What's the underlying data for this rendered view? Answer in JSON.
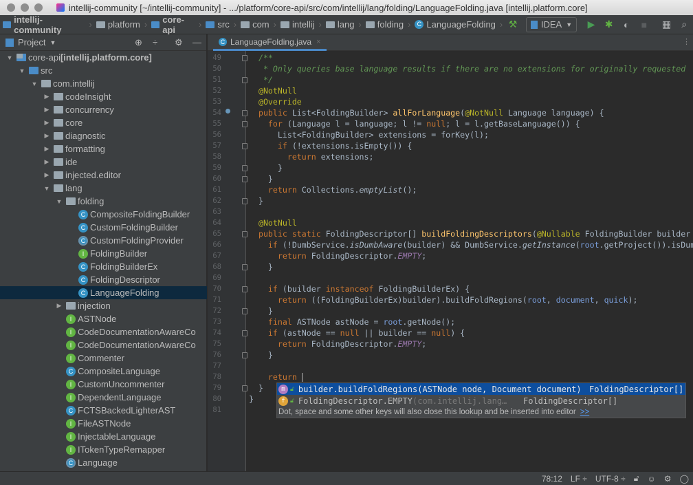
{
  "window": {
    "title": "intellij-community [~/intellij-community] - .../platform/core-api/src/com/intellij/lang/folding/LanguageFolding.java [intellij.platform.core]"
  },
  "navbar": {
    "crumbs": [
      {
        "label": "intellij-community",
        "icon": "module-folder-icon",
        "bold": true
      },
      {
        "label": "platform",
        "icon": "folder-icon",
        "bold": false
      },
      {
        "label": "core-api",
        "icon": "module-folder-icon",
        "bold": true
      },
      {
        "label": "src",
        "icon": "source-folder-icon",
        "bold": false
      },
      {
        "label": "com",
        "icon": "package-icon",
        "bold": false
      },
      {
        "label": "intellij",
        "icon": "package-icon",
        "bold": false
      },
      {
        "label": "lang",
        "icon": "package-icon",
        "bold": false
      },
      {
        "label": "folding",
        "icon": "package-icon",
        "bold": false
      },
      {
        "label": "LanguageFolding",
        "icon": "class-icon",
        "bold": false
      }
    ],
    "run_config": "IDEA"
  },
  "project_panel": {
    "title": "Project",
    "tree": [
      {
        "level": 0,
        "arrow": "open",
        "icon": "mod",
        "label": "core-api",
        "suffix": " [intellij.platform.core]"
      },
      {
        "level": 1,
        "arrow": "open",
        "icon": "srcf",
        "label": "src"
      },
      {
        "level": 2,
        "arrow": "open",
        "icon": "pkg",
        "label": "com.intellij"
      },
      {
        "level": 3,
        "arrow": "closed",
        "icon": "pkg",
        "label": "codeInsight"
      },
      {
        "level": 3,
        "arrow": "closed",
        "icon": "pkg",
        "label": "concurrency"
      },
      {
        "level": 3,
        "arrow": "closed",
        "icon": "pkg",
        "label": "core"
      },
      {
        "level": 3,
        "arrow": "closed",
        "icon": "pkg",
        "label": "diagnostic"
      },
      {
        "level": 3,
        "arrow": "closed",
        "icon": "pkg",
        "label": "formatting"
      },
      {
        "level": 3,
        "arrow": "closed",
        "icon": "pkg",
        "label": "ide"
      },
      {
        "level": 3,
        "arrow": "closed",
        "icon": "pkg",
        "label": "injected.editor"
      },
      {
        "level": 3,
        "arrow": "open",
        "icon": "pkg",
        "label": "lang"
      },
      {
        "level": 4,
        "arrow": "open",
        "icon": "pkg",
        "label": "folding"
      },
      {
        "level": 5,
        "arrow": "none",
        "icon": "class",
        "label": "CompositeFoldingBuilder"
      },
      {
        "level": 5,
        "arrow": "none",
        "icon": "class",
        "label": "CustomFoldingBuilder"
      },
      {
        "level": 5,
        "arrow": "none",
        "icon": "abstract",
        "label": "CustomFoldingProvider"
      },
      {
        "level": 5,
        "arrow": "none",
        "icon": "iface",
        "label": "FoldingBuilder"
      },
      {
        "level": 5,
        "arrow": "none",
        "icon": "class",
        "label": "FoldingBuilderEx"
      },
      {
        "level": 5,
        "arrow": "none",
        "icon": "class",
        "label": "FoldingDescriptor"
      },
      {
        "level": 5,
        "arrow": "none",
        "icon": "class",
        "label": "LanguageFolding",
        "selected": true
      },
      {
        "level": 4,
        "arrow": "closed",
        "icon": "pkg",
        "label": "injection"
      },
      {
        "level": 4,
        "arrow": "none",
        "icon": "iface",
        "label": "ASTNode"
      },
      {
        "level": 4,
        "arrow": "none",
        "icon": "iface",
        "label": "CodeDocumentationAwareCo"
      },
      {
        "level": 4,
        "arrow": "none",
        "icon": "iface",
        "label": "CodeDocumentationAwareCo"
      },
      {
        "level": 4,
        "arrow": "none",
        "icon": "iface",
        "label": "Commenter"
      },
      {
        "level": 4,
        "arrow": "none",
        "icon": "class",
        "label": "CompositeLanguage"
      },
      {
        "level": 4,
        "arrow": "none",
        "icon": "iface",
        "label": "CustomUncommenter"
      },
      {
        "level": 4,
        "arrow": "none",
        "icon": "iface",
        "label": "DependentLanguage"
      },
      {
        "level": 4,
        "arrow": "none",
        "icon": "class",
        "label": "FCTSBackedLighterAST"
      },
      {
        "level": 4,
        "arrow": "none",
        "icon": "iface",
        "label": "FileASTNode"
      },
      {
        "level": 4,
        "arrow": "none",
        "icon": "iface",
        "label": "InjectableLanguage"
      },
      {
        "level": 4,
        "arrow": "none",
        "icon": "iface",
        "label": "ITokenTypeRemapper"
      },
      {
        "level": 4,
        "arrow": "none",
        "icon": "abstract",
        "label": "Language"
      }
    ]
  },
  "editor": {
    "tab": "LanguageFolding.java",
    "first_line": 49,
    "lines": [
      [
        [
          "c",
          "  /**"
        ]
      ],
      [
        [
          "c",
          "   * Only queries base language results if there are no extensions for originally requested"
        ]
      ],
      [
        [
          "c",
          "   */"
        ]
      ],
      [
        [
          "a",
          "  @NotNull"
        ]
      ],
      [
        [
          "a",
          "  @Override"
        ]
      ],
      [
        [
          "k",
          "  public "
        ],
        [
          "d",
          "List<FoldingBuilder> "
        ],
        [
          "m",
          "allForLanguage"
        ],
        [
          "d",
          "("
        ],
        [
          "a",
          "@NotNull "
        ],
        [
          "d",
          "Language language) {"
        ]
      ],
      [
        [
          "k",
          "    for "
        ],
        [
          "d",
          "(Language l = language; l != "
        ],
        [
          "k",
          "null"
        ],
        [
          "d",
          "; l = l.getBaseLanguage()) {"
        ]
      ],
      [
        [
          "d",
          "      List<FoldingBuilder> extensions = forKey(l);"
        ]
      ],
      [
        [
          "k",
          "      if "
        ],
        [
          "d",
          "(!extensions.isEmpty()) {"
        ]
      ],
      [
        [
          "k",
          "        return "
        ],
        [
          "d",
          "extensions;"
        ]
      ],
      [
        [
          "d",
          "      }"
        ]
      ],
      [
        [
          "d",
          "    }"
        ]
      ],
      [
        [
          "k",
          "    return "
        ],
        [
          "d",
          "Collections."
        ],
        [
          "i",
          "emptyList"
        ],
        [
          "d",
          "();"
        ]
      ],
      [
        [
          "d",
          "  }"
        ]
      ],
      [],
      [
        [
          "a",
          "  @NotNull"
        ]
      ],
      [
        [
          "k",
          "  public static "
        ],
        [
          "d",
          "FoldingDescriptor[] "
        ],
        [
          "m",
          "buildFoldingDescriptors"
        ],
        [
          "d",
          "("
        ],
        [
          "a",
          "@Nullable "
        ],
        [
          "d",
          "FoldingBuilder builder"
        ]
      ],
      [
        [
          "k",
          "    if "
        ],
        [
          "d",
          "(!DumbService."
        ],
        [
          "i",
          "isDumbAware"
        ],
        [
          "d",
          "(builder) && DumbService."
        ],
        [
          "i",
          "getInstance"
        ],
        [
          "d",
          "("
        ],
        [
          "p",
          "root"
        ],
        [
          "d",
          ".getProject()).isDum"
        ]
      ],
      [
        [
          "k",
          "      return "
        ],
        [
          "d",
          "FoldingDescriptor."
        ],
        [
          "fi2",
          "EMPTY"
        ],
        [
          "d",
          ";"
        ]
      ],
      [
        [
          "d",
          "    }"
        ]
      ],
      [],
      [
        [
          "k",
          "    if "
        ],
        [
          "d",
          "(builder "
        ],
        [
          "k",
          "instanceof "
        ],
        [
          "d",
          "FoldingBuilderEx) {"
        ]
      ],
      [
        [
          "k",
          "      return "
        ],
        [
          "d",
          "((FoldingBuilderEx)builder).buildFoldRegions("
        ],
        [
          "p",
          "root"
        ],
        [
          "d",
          ", "
        ],
        [
          "p",
          "document"
        ],
        [
          "d",
          ", "
        ],
        [
          "p",
          "quick"
        ],
        [
          "d",
          ");"
        ]
      ],
      [
        [
          "d",
          "    }"
        ]
      ],
      [
        [
          "k",
          "    final "
        ],
        [
          "d",
          "ASTNode astNode = "
        ],
        [
          "p",
          "root"
        ],
        [
          "d",
          ".getNode();"
        ]
      ],
      [
        [
          "k",
          "    if "
        ],
        [
          "d",
          "(astNode == "
        ],
        [
          "k",
          "null "
        ],
        [
          "d",
          "|| builder == "
        ],
        [
          "k",
          "null"
        ],
        [
          "d",
          ") {"
        ]
      ],
      [
        [
          "k",
          "      return "
        ],
        [
          "d",
          "FoldingDescriptor."
        ],
        [
          "fi2",
          "EMPTY"
        ],
        [
          "d",
          ";"
        ]
      ],
      [
        [
          "d",
          "    }"
        ]
      ],
      [],
      [
        [
          "k",
          "    return "
        ]
      ],
      [
        [
          "d",
          "  }"
        ]
      ],
      [
        [
          "d",
          "}"
        ]
      ],
      []
    ],
    "cursor": "78:12"
  },
  "completion": {
    "items": [
      {
        "icon": "m",
        "label": "builder.buildFoldRegions(ASTNode node, Document document)",
        "detail": "",
        "type": "FoldingDescriptor[]",
        "selected": true
      },
      {
        "icon": "f",
        "label": "FoldingDescriptor.EMPTY",
        "detail": " (com.intellij.lang…",
        "type": "FoldingDescriptor[]",
        "selected": false
      }
    ],
    "hint": "Dot, space and some other keys will also close this lookup and be inserted into editor",
    "hint_link": ">>"
  },
  "statusbar": {
    "position": "78:12",
    "line_sep": "LF ÷",
    "encoding": "UTF-8 ÷"
  },
  "colors": {
    "keyword": "#CC7832",
    "annotation": "#BBB529",
    "selection": "#0D4E9E"
  }
}
